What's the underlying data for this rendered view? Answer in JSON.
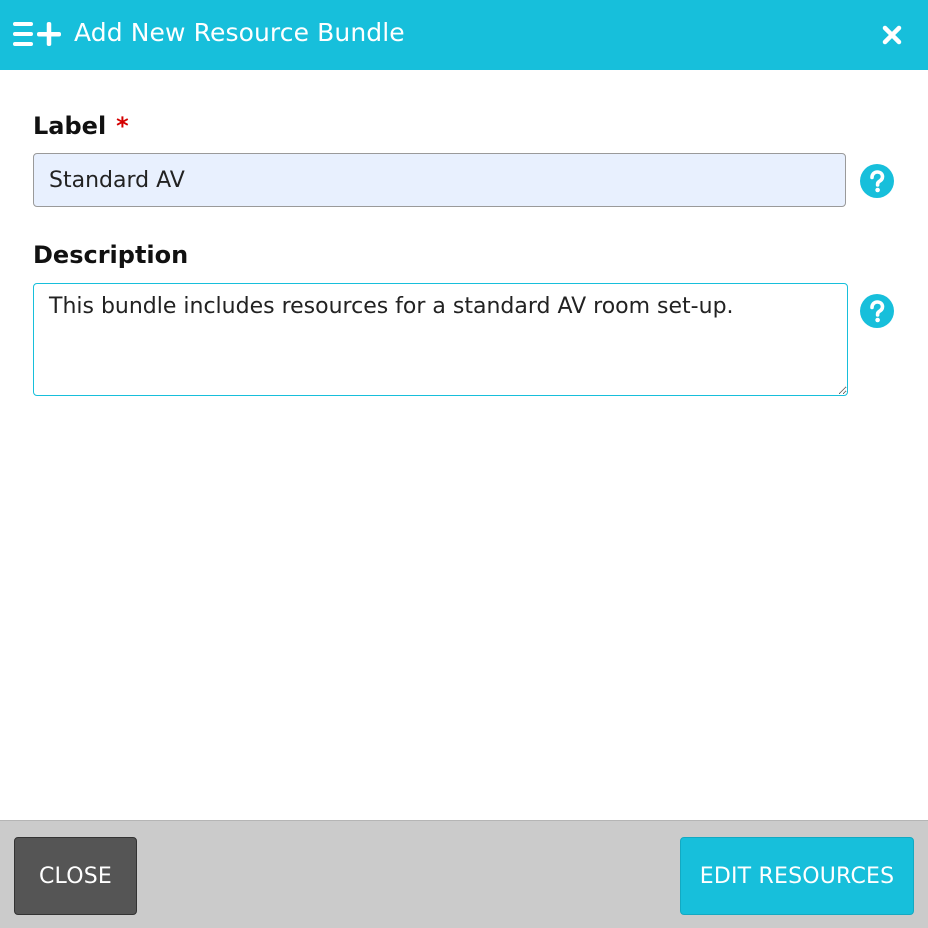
{
  "dialog": {
    "title": "Add New Resource Bundle",
    "title_icon": "list-add-icon",
    "close_icon": "close-icon"
  },
  "fields": {
    "label": {
      "label": "Label",
      "required_marker": "*",
      "value": "Standard AV",
      "help_icon": "question-circle-icon"
    },
    "description": {
      "label": "Description",
      "value": "This bundle includes resources for a standard AV room set-up.",
      "help_icon": "question-circle-icon"
    }
  },
  "footer": {
    "close_label": "CLOSE",
    "edit_resources_label": "EDIT RESOURCES"
  },
  "colors": {
    "accent": "#17bfdb",
    "required": "#d40000",
    "close_button": "#555555",
    "footer_bg": "#cbcbcb",
    "autofill_bg": "#e8f0fe"
  }
}
